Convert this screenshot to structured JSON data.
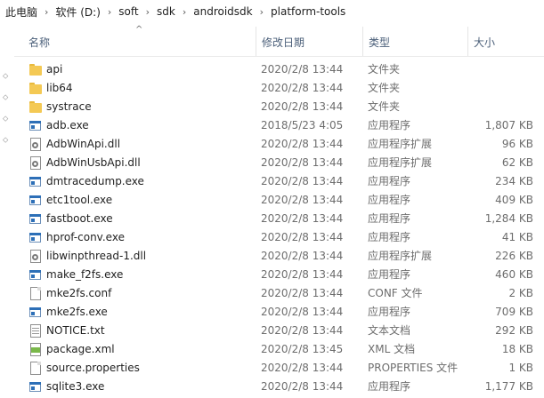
{
  "breadcrumb": {
    "items": [
      "此电脑",
      "软件 (D:)",
      "soft",
      "sdk",
      "androidsdk",
      "platform-tools"
    ],
    "separator": "›"
  },
  "columns": {
    "name": "名称",
    "date": "修改日期",
    "type": "类型",
    "size": "大小"
  },
  "files": [
    {
      "name": "api",
      "date": "2020/2/8 13:44",
      "type": "文件夹",
      "size": "",
      "icon": "folder-icon"
    },
    {
      "name": "lib64",
      "date": "2020/2/8 13:44",
      "type": "文件夹",
      "size": "",
      "icon": "folder-icon"
    },
    {
      "name": "systrace",
      "date": "2020/2/8 13:44",
      "type": "文件夹",
      "size": "",
      "icon": "folder-icon"
    },
    {
      "name": "adb.exe",
      "date": "2018/5/23 4:05",
      "type": "应用程序",
      "size": "1,807 KB",
      "icon": "exe-icon"
    },
    {
      "name": "AdbWinApi.dll",
      "date": "2020/2/8 13:44",
      "type": "应用程序扩展",
      "size": "96 KB",
      "icon": "dll-icon"
    },
    {
      "name": "AdbWinUsbApi.dll",
      "date": "2020/2/8 13:44",
      "type": "应用程序扩展",
      "size": "62 KB",
      "icon": "dll-icon"
    },
    {
      "name": "dmtracedump.exe",
      "date": "2020/2/8 13:44",
      "type": "应用程序",
      "size": "234 KB",
      "icon": "exe-icon"
    },
    {
      "name": "etc1tool.exe",
      "date": "2020/2/8 13:44",
      "type": "应用程序",
      "size": "409 KB",
      "icon": "exe-icon"
    },
    {
      "name": "fastboot.exe",
      "date": "2020/2/8 13:44",
      "type": "应用程序",
      "size": "1,284 KB",
      "icon": "exe-icon"
    },
    {
      "name": "hprof-conv.exe",
      "date": "2020/2/8 13:44",
      "type": "应用程序",
      "size": "41 KB",
      "icon": "exe-icon"
    },
    {
      "name": "libwinpthread-1.dll",
      "date": "2020/2/8 13:44",
      "type": "应用程序扩展",
      "size": "226 KB",
      "icon": "dll-icon"
    },
    {
      "name": "make_f2fs.exe",
      "date": "2020/2/8 13:44",
      "type": "应用程序",
      "size": "460 KB",
      "icon": "exe-icon"
    },
    {
      "name": "mke2fs.conf",
      "date": "2020/2/8 13:44",
      "type": "CONF 文件",
      "size": "2 KB",
      "icon": "file-icon"
    },
    {
      "name": "mke2fs.exe",
      "date": "2020/2/8 13:44",
      "type": "应用程序",
      "size": "709 KB",
      "icon": "exe-icon"
    },
    {
      "name": "NOTICE.txt",
      "date": "2020/2/8 13:44",
      "type": "文本文档",
      "size": "292 KB",
      "icon": "text-file-icon"
    },
    {
      "name": "package.xml",
      "date": "2020/2/8 13:45",
      "type": "XML 文档",
      "size": "18 KB",
      "icon": "xml-file-icon"
    },
    {
      "name": "source.properties",
      "date": "2020/2/8 13:44",
      "type": "PROPERTIES 文件",
      "size": "1 KB",
      "icon": "file-icon"
    },
    {
      "name": "sqlite3.exe",
      "date": "2020/2/8 13:44",
      "type": "应用程序",
      "size": "1,177 KB",
      "icon": "exe-icon"
    }
  ]
}
